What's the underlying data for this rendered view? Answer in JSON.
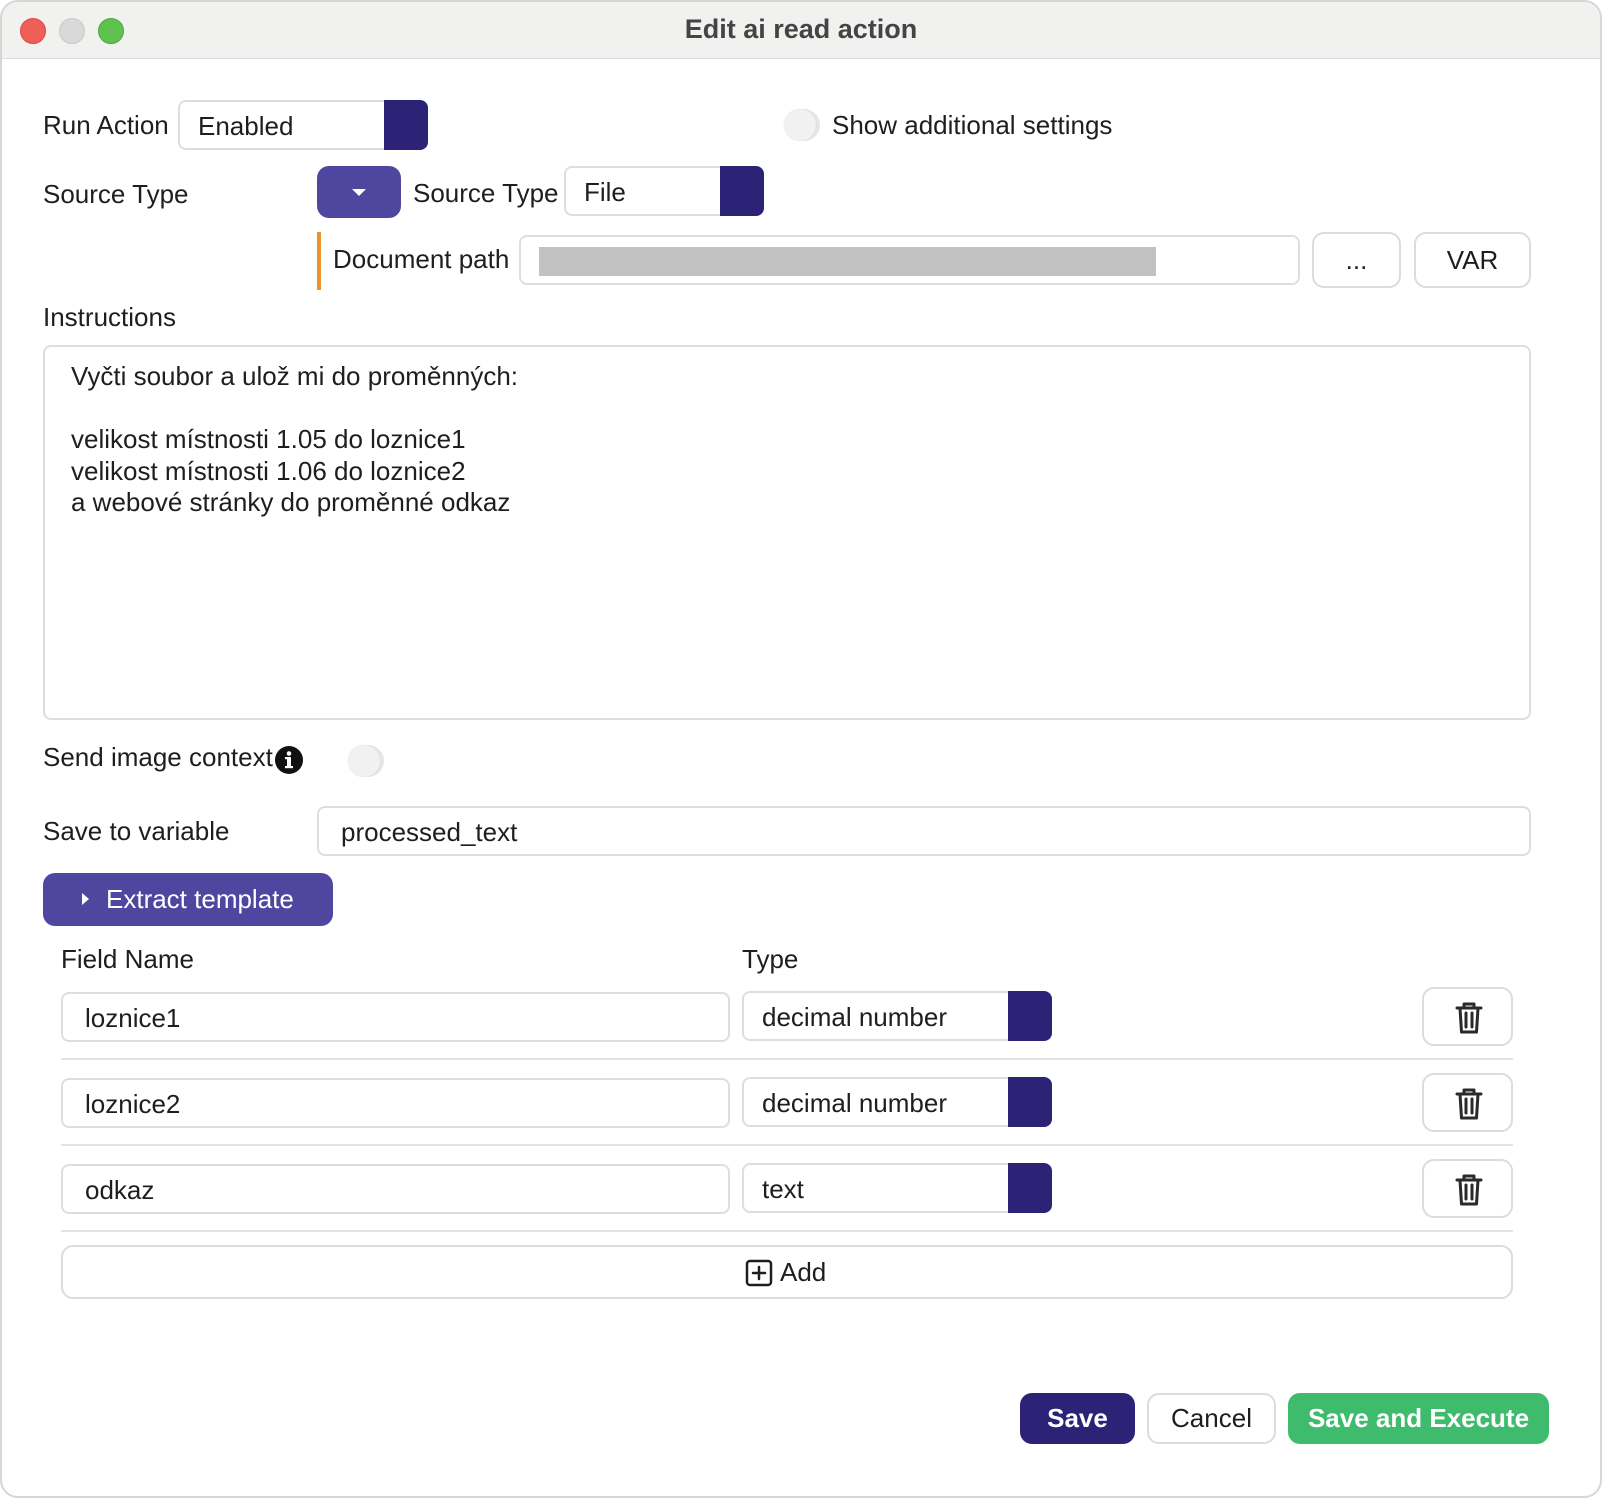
{
  "window": {
    "title": "Edit ai read action"
  },
  "run_action": {
    "label": "Run Action",
    "value": "Enabled"
  },
  "additional_settings": {
    "label": "Show additional settings",
    "enabled": false
  },
  "source_type": {
    "label": "Source Type",
    "inner_label": "Source Type",
    "value": "File"
  },
  "document_path": {
    "label": "Document path",
    "value": "",
    "browse_label": "...",
    "var_label": "VAR"
  },
  "instructions": {
    "label": "Instructions",
    "value": "Vyčti soubor a ulož mi do proměnných:\n\nvelikost místnosti 1.05 do loznice1\nvelikost místnosti 1.06 do loznice2\na webové stránky do proměnné odkaz"
  },
  "image_context": {
    "label": "Send image context",
    "enabled": false
  },
  "save_to_variable": {
    "label": "Save to variable",
    "value": "processed_text"
  },
  "extract_template": {
    "label": "Extract template",
    "col_field": "Field Name",
    "col_type": "Type",
    "rows": [
      {
        "name": "loznice1",
        "type": "decimal number"
      },
      {
        "name": "loznice2",
        "type": "decimal number"
      },
      {
        "name": "odkaz",
        "type": "text"
      }
    ],
    "add_label": "Add"
  },
  "footer": {
    "save": "Save",
    "cancel": "Cancel",
    "save_execute": "Save and Execute"
  },
  "colors": {
    "accent": "#2c2276",
    "accent_light": "#5a4fa8",
    "green": "#3fbb6d",
    "orange": "#e8952c"
  }
}
